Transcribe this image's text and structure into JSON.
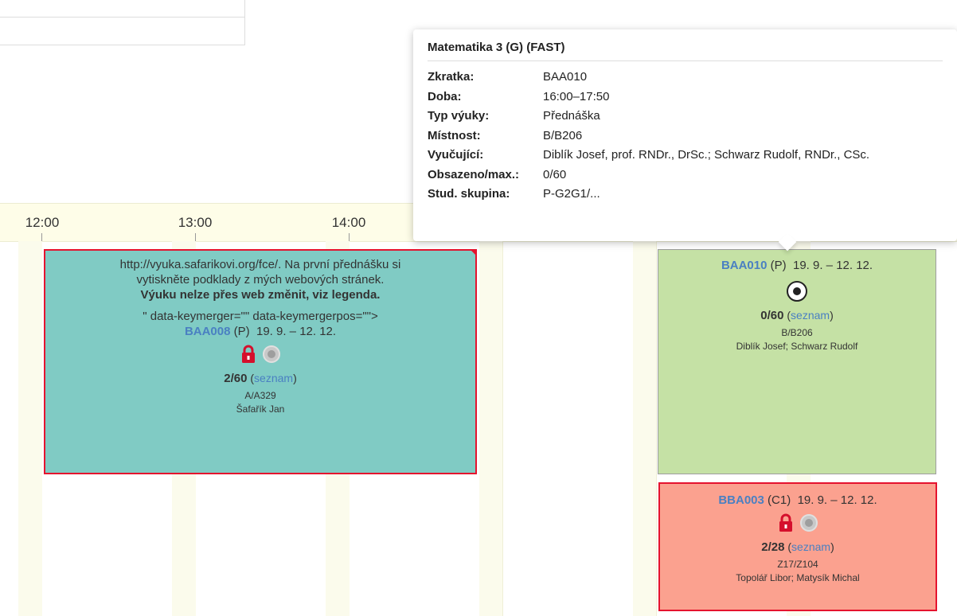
{
  "timeline": {
    "hours": [
      "12:00",
      "13:00",
      "14:00"
    ]
  },
  "events": [
    {
      "note_line1": "http://vyuka.safarikovi.org/fce/. Na první přednášku si",
      "note_line2": "vytiskněte podklady z mých webových stránek.",
      "note_bold": "Výuku nelze přes web změnit, viz legenda.",
      "artifact": "\" data-keymerger=\"\" data-keymergerpos=\"\">",
      "code": "BAA008",
      "type": "(P)",
      "dates": "19. 9. – 12. 12.",
      "capacity": "2/60",
      "list_link": "seznam",
      "room": "A/A329",
      "teacher": "Šafařík Jan",
      "icons": [
        "lock-icon",
        "radio-disabled-icon"
      ],
      "color": "#80cbc4"
    },
    {
      "code": "BAA010",
      "type": "(P)",
      "dates": "19. 9. – 12. 12.",
      "capacity": "0/60",
      "list_link": "seznam",
      "room": "B/B206",
      "teacher": "Diblík Josef; Schwarz Rudolf",
      "icons": [
        "radio-selected-icon"
      ],
      "color": "#c5e1a5"
    },
    {
      "code": "BBA003",
      "type": "(C1)",
      "dates": "19. 9. – 12. 12.",
      "capacity": "2/28",
      "list_link": "seznam",
      "room": "Z17/Z104",
      "teacher": "Topolář Libor; Matysík Michal",
      "icons": [
        "lock-icon",
        "radio-disabled-icon"
      ],
      "color": "#fba18f"
    }
  ],
  "tooltip": {
    "title": "Matematika 3 (G) (FAST)",
    "rows": [
      {
        "label": "Zkratka:",
        "value": "BAA010"
      },
      {
        "label": "Doba:",
        "value": "16:00–17:50"
      },
      {
        "label": "Typ výuky:",
        "value": "Přednáška"
      },
      {
        "label": "Místnost:",
        "value": "B/B206"
      },
      {
        "label": "Vyučující:",
        "value": "Diblík Josef, prof. RNDr., DrSc.; Schwarz Rudolf, RNDr., CSc."
      },
      {
        "label": "Obsazeno/max.:",
        "value": "0/60"
      },
      {
        "label": "Stud. skupina:",
        "value": "P-G2G1/..."
      }
    ]
  },
  "colors": {
    "accent_link": "#4a80c2",
    "locked_border": "#e5132e",
    "lock_icon": "#d50f2c"
  }
}
